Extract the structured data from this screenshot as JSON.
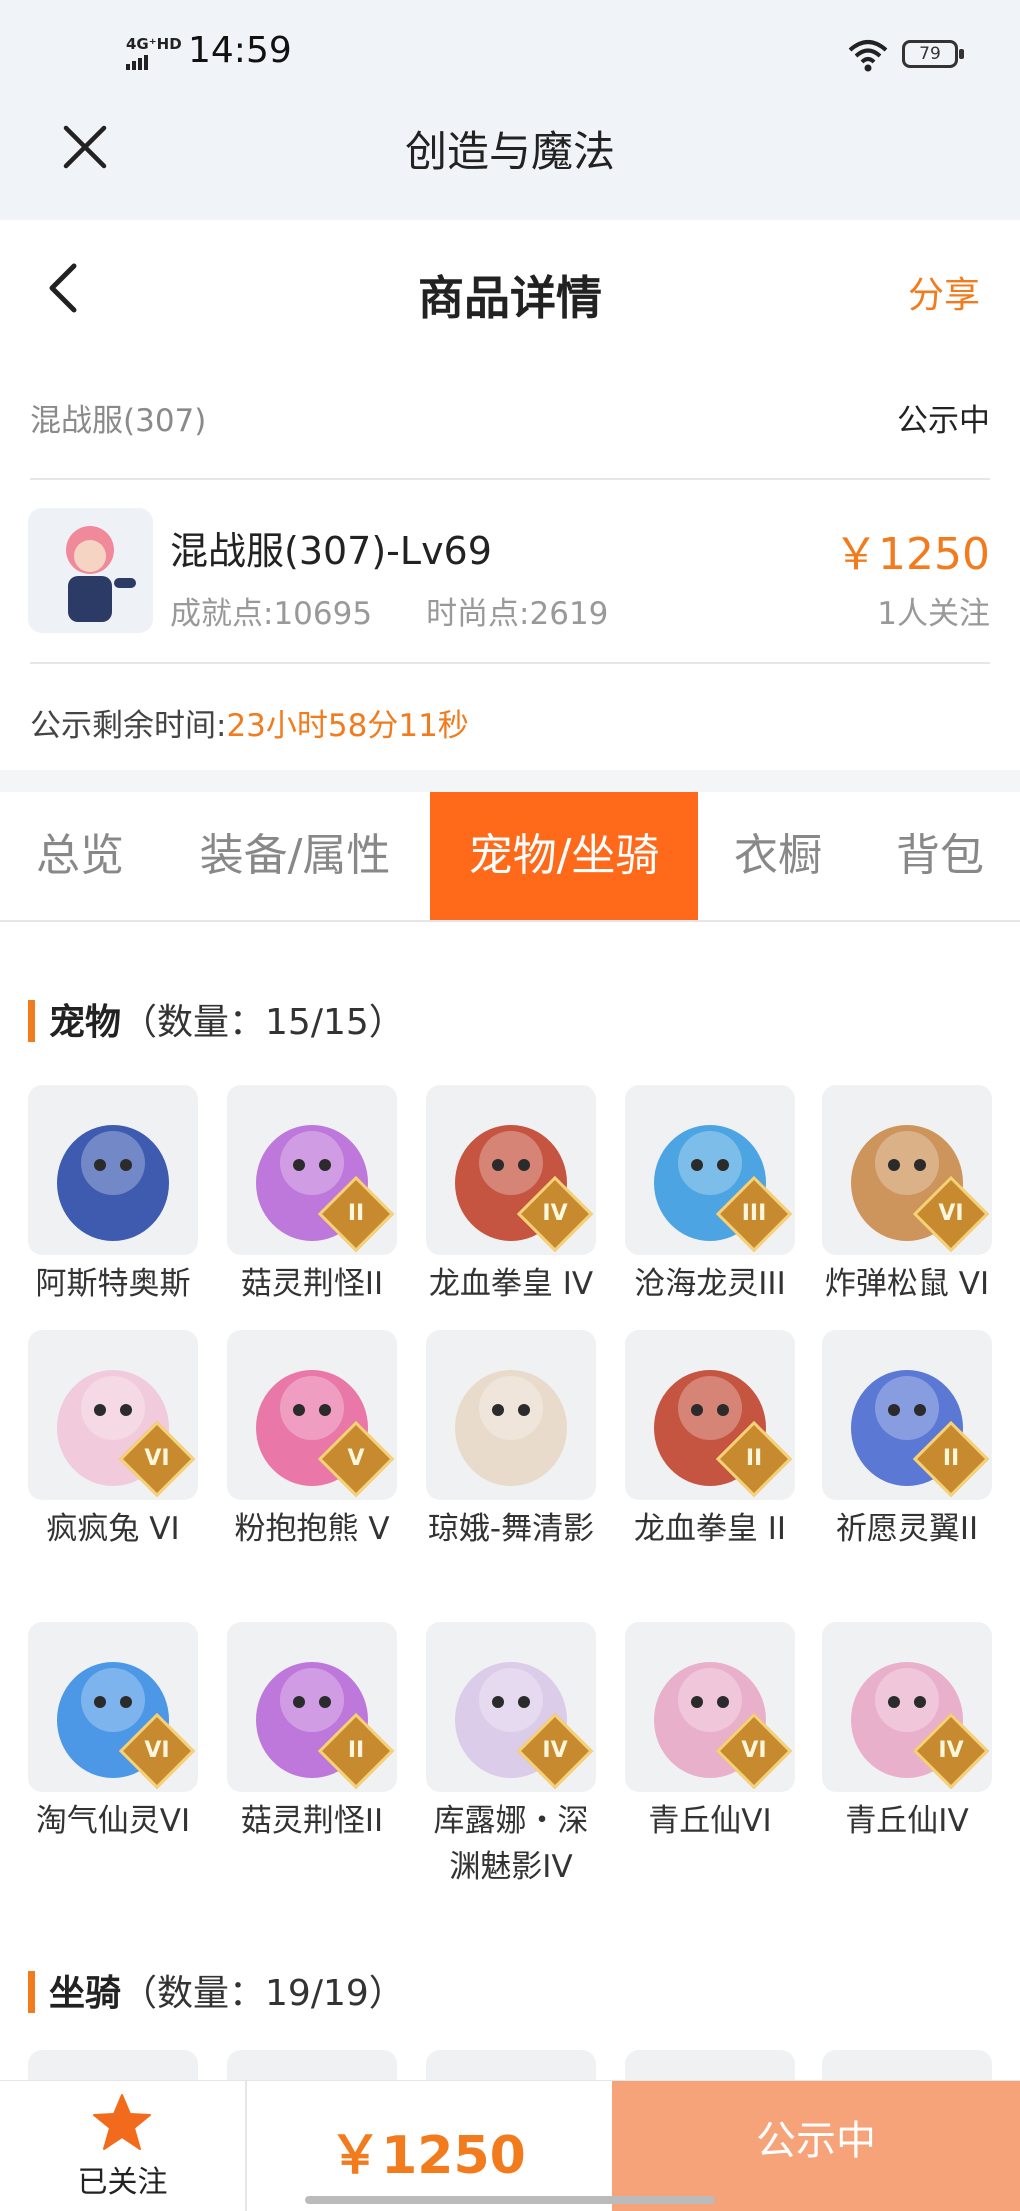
{
  "status_bar": {
    "network": "4G⁺HD",
    "time": "14:59",
    "battery": "79"
  },
  "app": {
    "title": "创造与魔法"
  },
  "header": {
    "title": "商品详情",
    "share": "分享"
  },
  "listing": {
    "server": "混战服(307)",
    "status": "公示中",
    "character_name": "混战服(307)-Lv69",
    "achievement": "成就点:10695",
    "fashion": "时尚点:2619",
    "price": "￥1250",
    "followers": "1人关注",
    "remain_label": "公示剩余时间:",
    "remain_value": "23小时58分11秒"
  },
  "tabs": [
    {
      "label": "总览"
    },
    {
      "label": "装备/属性"
    },
    {
      "label": "宠物/坐骑"
    },
    {
      "label": "衣橱"
    },
    {
      "label": "背包"
    }
  ],
  "active_tab": "宠物/坐骑",
  "pets_section": {
    "title": "宠物",
    "count": "（数量：15/15）"
  },
  "pets": [
    {
      "name": "阿斯特奥斯",
      "badge": "",
      "color": "#2a4aa8"
    },
    {
      "name": "菇灵荆怪II",
      "badge": "II",
      "color": "#b86ad8"
    },
    {
      "name": "龙血拳皇 IV",
      "badge": "IV",
      "color": "#c0442e"
    },
    {
      "name": "沧海龙灵III",
      "badge": "III",
      "color": "#3a9be0"
    },
    {
      "name": "炸弹松鼠 VI",
      "badge": "VI",
      "color": "#c98a4a"
    },
    {
      "name": "疯疯兔 VI",
      "badge": "VI",
      "color": "#f1c6d8"
    },
    {
      "name": "粉抱抱熊 V",
      "badge": "V",
      "color": "#e86aa0"
    },
    {
      "name": "琼娥-舞清影",
      "badge": "",
      "color": "#e8d8c8"
    },
    {
      "name": "龙血拳皇 II",
      "badge": "II",
      "color": "#c0442e"
    },
    {
      "name": "祈愿灵翼II",
      "badge": "II",
      "color": "#4a6ad0"
    },
    {
      "name": "淘气仙灵VI",
      "badge": "VI",
      "color": "#3a8ee6"
    },
    {
      "name": "菇灵荆怪II",
      "badge": "II",
      "color": "#b86ad8"
    },
    {
      "name": "库露娜・深渊魅影IV",
      "badge": "IV",
      "color": "#d8c8e8"
    },
    {
      "name": "青丘仙VI",
      "badge": "VI",
      "color": "#e8a8c8"
    },
    {
      "name": "青丘仙IV",
      "badge": "IV",
      "color": "#e8a8c8"
    }
  ],
  "mounts_section": {
    "title": "坐骑",
    "count": "（数量：19/19）"
  },
  "bottom_bar": {
    "follow_label": "已关注",
    "price": "￥1250",
    "action": "公示中"
  },
  "colors": {
    "accent": "#f27b1e",
    "tab_active": "#ff6a1a",
    "action_bg": "#f6a37a"
  }
}
